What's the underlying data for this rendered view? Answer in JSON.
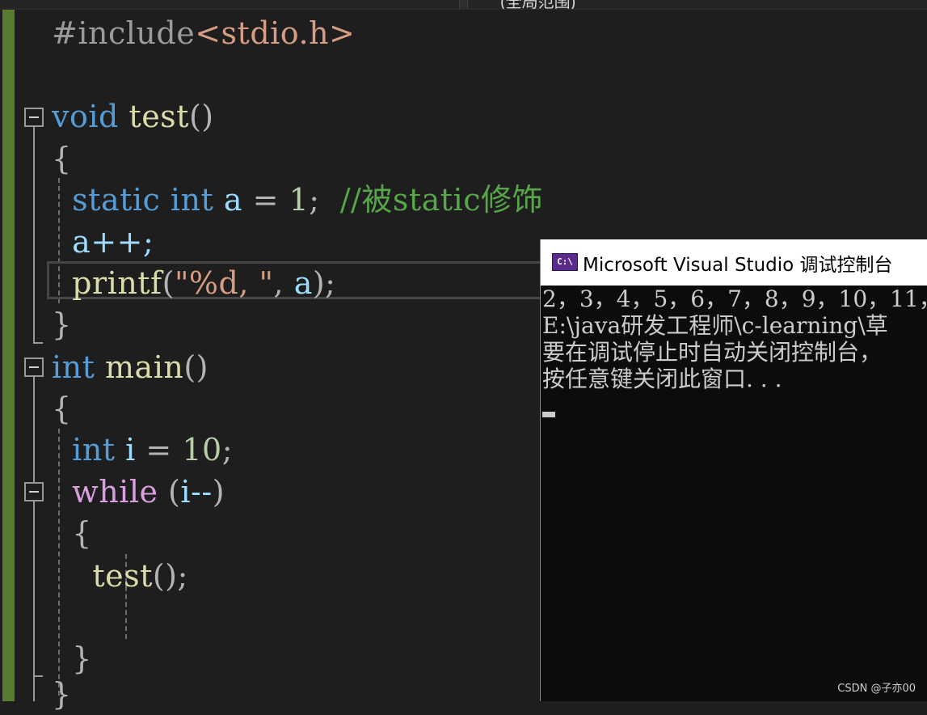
{
  "top_tab": {
    "right_label": "(全局范围)"
  },
  "code": {
    "include_directive": "#include",
    "include_file": "<stdio.h>",
    "test_void": "void",
    "test_name": "test",
    "test_parens": "()",
    "open_brace": "{",
    "close_brace": "}",
    "static_kw": "static",
    "int_kw": "int",
    "var_a": "a",
    "eq": " = ",
    "one": "1",
    "semicolon": ";",
    "comment": "//被static修饰",
    "a_inc": "a++;",
    "printf_name": "printf",
    "printf_open": "(",
    "printf_fmt": "\"%d, \"",
    "printf_comma": ", ",
    "printf_close": ");",
    "main_int": "int",
    "main_name": "main",
    "main_parens": "()",
    "var_i": "i",
    "ten": "10",
    "while_kw": "while",
    "while_open": " (",
    "while_cond": "i--",
    "while_close": ")",
    "call_test": "test",
    "call_close": "();"
  },
  "console": {
    "title": "Microsoft Visual Studio 调试控制台",
    "icon_label": "C:\\",
    "lines": [
      "2，3，4，5，6，7，8，9，10，11，",
      "E:\\java研发工程师\\c-learning\\草",
      "要在调试停止时自动关闭控制台，",
      "按任意键关闭此窗口. . ."
    ]
  },
  "watermark": "CSDN @子亦00"
}
